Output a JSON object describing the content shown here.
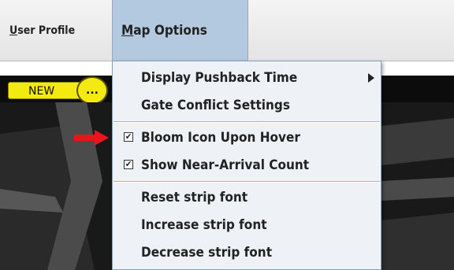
{
  "menubar": {
    "user_profile": {
      "mnemonic": "U",
      "rest": "ser Profile"
    },
    "map_options": {
      "mnemonic": "M",
      "rest": "ap Options"
    }
  },
  "toolbar": {
    "new_label": "NEW",
    "more_label": "..."
  },
  "map_options_menu": {
    "display_pushback_time": "Display Pushback Time",
    "gate_conflict_settings": "Gate Conflict Settings",
    "bloom_icon_upon_hover": "Bloom Icon Upon Hover",
    "show_near_arrival_count": "Show Near-Arrival Count",
    "reset_strip_font": "Reset strip font",
    "increase_strip_font": "Increase strip font",
    "decrease_strip_font": "Decrease strip font",
    "check_mark": "✔"
  },
  "colors": {
    "menubar_bg": "#e8e8e8",
    "menu_highlight": "#b3c9e0",
    "dropdown_bg": "#eef2f6",
    "button_yellow": "#f2ea10",
    "arrow_red": "#e8161c",
    "map_bg": "#191919"
  },
  "icons": {
    "submenu_arrow": "submenu-arrow-icon",
    "pointer_arrow": "red-arrow-icon",
    "checkbox": "checkbox-icon"
  }
}
